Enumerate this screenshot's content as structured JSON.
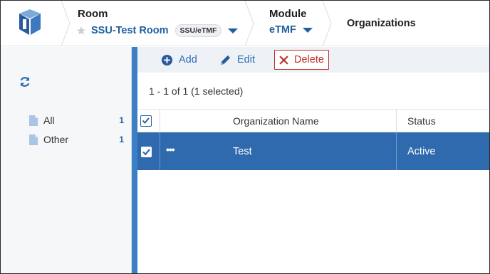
{
  "header": {
    "room_label": "Room",
    "room_name": "SSU-Test Room",
    "room_badge": "SSU/eTMF",
    "module_label": "Module",
    "module_value": "eTMF",
    "current_page": "Organizations"
  },
  "sidebar": {
    "folders": [
      {
        "label": "All",
        "count": "1"
      },
      {
        "label": "Other",
        "count": "1"
      }
    ]
  },
  "toolbar": {
    "add_label": "Add",
    "edit_label": "Edit",
    "delete_label": "Delete"
  },
  "grid": {
    "range_text": "1 - 1 of 1 (1 selected)",
    "columns": [
      "Organization Name",
      "Status"
    ],
    "rows": [
      {
        "menu": "•••",
        "name": "Test",
        "status": "Active",
        "selected": true
      }
    ]
  },
  "colors": {
    "accent": "#1f5fa0",
    "selected_row": "#2e6aad",
    "splitter": "#3b7fc4",
    "delete": "#c0302b"
  },
  "icons": [
    "logo-icon",
    "star-icon",
    "caret-down-icon",
    "refresh-icon",
    "folder-icon",
    "add-circle-icon",
    "pencil-icon",
    "close-x-icon",
    "checkbox-icon"
  ]
}
